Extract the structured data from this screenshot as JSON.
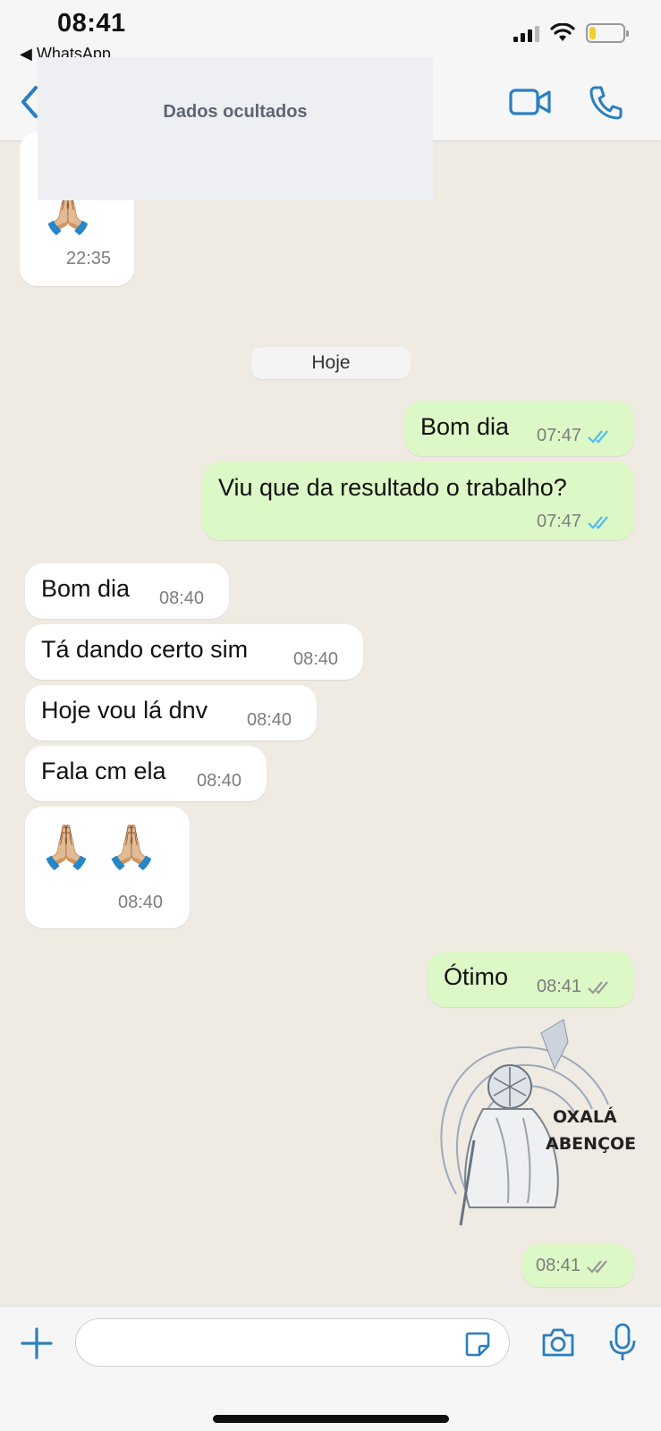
{
  "status_bar": {
    "time": "08:41",
    "back_app": "◀ WhatsApp",
    "battery_level": 0.2
  },
  "header": {
    "hidden_label": "Dados ocultados"
  },
  "date_divider": "Hoje",
  "messages": [
    {
      "emoji": "🙏🏼",
      "time": "22:35"
    },
    {
      "text": "Bom dia",
      "time": "07:47"
    },
    {
      "text": "Viu que da resultado o trabalho?",
      "time": "07:47"
    },
    {
      "text": "Bom dia",
      "time": "08:40"
    },
    {
      "text": "Tá dando certo sim",
      "time": "08:40"
    },
    {
      "text": "Hoje vou lá dnv",
      "time": "08:40"
    },
    {
      "text": "Fala cm ela",
      "time": "08:40"
    },
    {
      "emoji": "🙏🏼 🙏🏼",
      "time": "08:40"
    },
    {
      "text": "Ótimo",
      "time": "08:41"
    },
    {
      "time": "08:41"
    }
  ],
  "sticker": {
    "line1": "OXALÁ",
    "line2": "ABENÇOE"
  },
  "colors": {
    "accent": "#2a7fc1",
    "read_ticks": "#53bdeb",
    "outgoing_bubble": "#dcf8c6",
    "incoming_bubble": "#ffffff"
  },
  "icons": [
    "back-chevron-icon",
    "video-call-icon",
    "phone-icon",
    "plus-icon",
    "sticker-icon",
    "camera-icon",
    "microphone-icon"
  ],
  "composer": {
    "placeholder": ""
  }
}
